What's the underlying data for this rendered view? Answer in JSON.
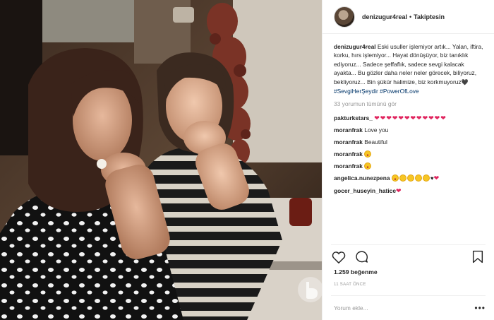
{
  "post": {
    "username": "denizugur4real",
    "separator": "•",
    "follow_status": "Takiptesin",
    "caption": {
      "username": "denizugur4real",
      "text": "Eski usuller işlemiyor artık... Yalan, iftira, korku, hırs işlemiyor... Hayat dönüşüyor, biz tanıklık ediyoruz... Sadece şeffaflık, sadece sevgi kalacak ayakta... Bu gözler daha neler neler görecek, biliyoruz, bekliyoruz... Bin şükür halimize, biz korkmuyoruz",
      "heart": "🖤",
      "hashtag1": "#SevgiHerŞeydir",
      "hashtag2": "#PowerOfLove"
    },
    "view_all_comments": "33 yorumun tümünü gör",
    "comments": [
      {
        "user": "pakturkstars_",
        "text": "❤❤❤❤❤❤❤❤❤❤❤❤"
      },
      {
        "user": "moranfrak",
        "text": "Love you"
      },
      {
        "user": "moranfrak",
        "text": "Beautiful"
      },
      {
        "user": "moranfrak",
        "text": ""
      },
      {
        "user": "moranfrak",
        "text": ""
      },
      {
        "user": "angelica.nunezpena",
        "text": ""
      },
      {
        "user": "gocer_huseyin_hatice",
        "text": "❤"
      }
    ],
    "likes": "1.259 beğenme",
    "timestamp": "11 SAAT ÖNCE",
    "comment_placeholder": "Yorum ekle...",
    "more_label": "•••"
  },
  "icons": {
    "like": "heart-outline-icon",
    "comment": "speech-bubble-icon",
    "save": "bookmark-icon"
  },
  "colors": {
    "hashtag": "#003569",
    "red_heart": "#e0245e",
    "muted": "#999999",
    "text": "#262626"
  }
}
